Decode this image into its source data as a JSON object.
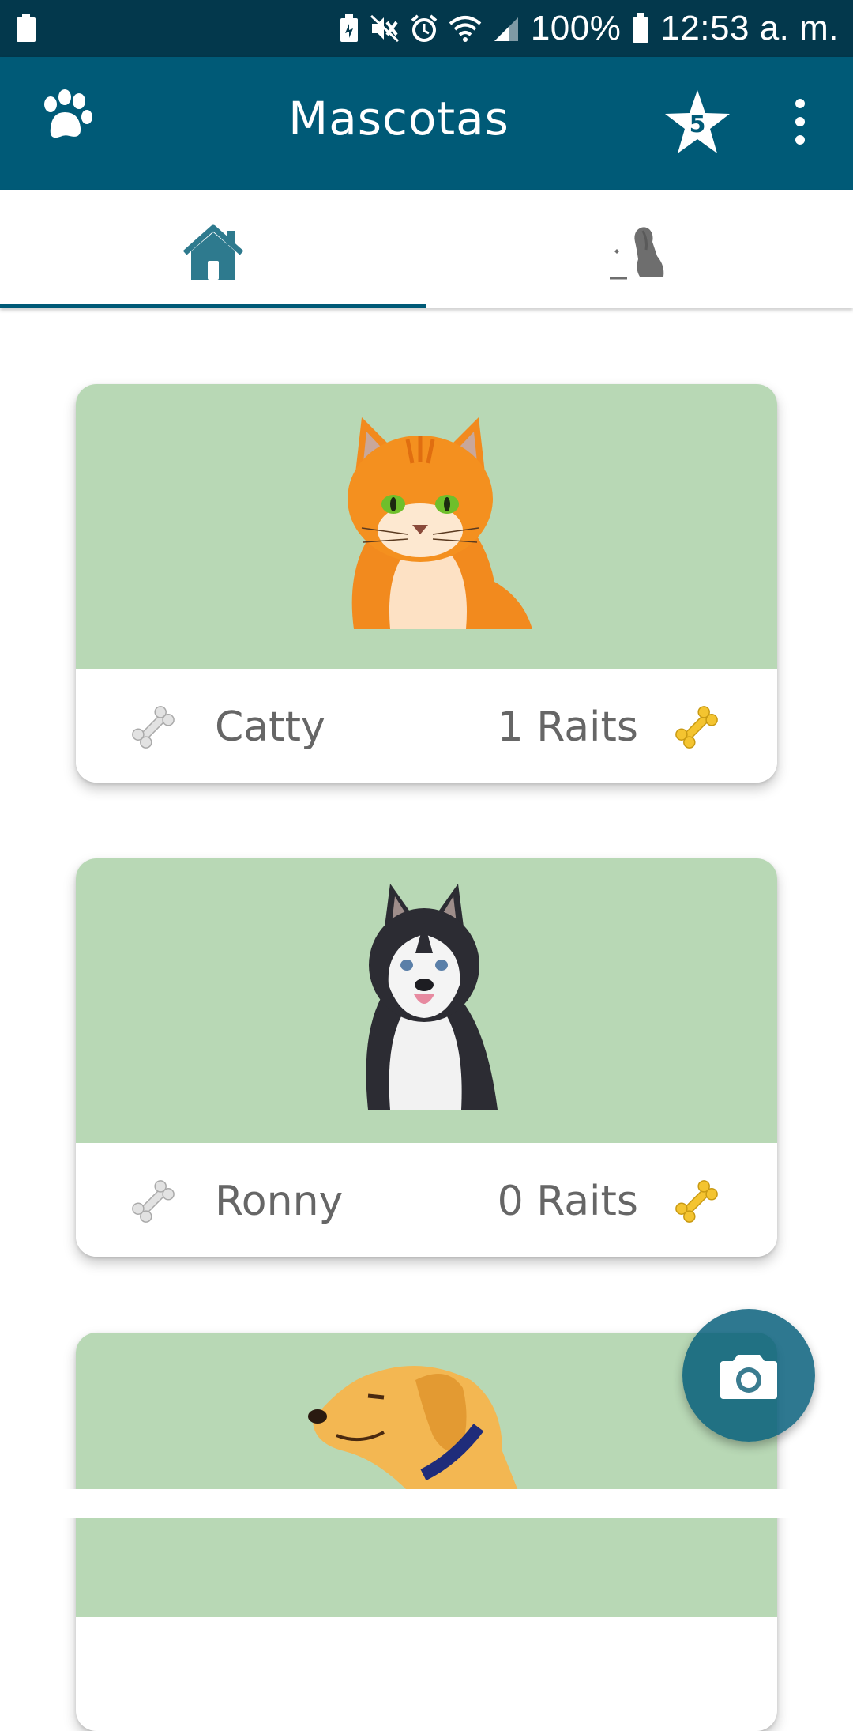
{
  "status_bar": {
    "battery_badge": "100",
    "battery_percent": "100%",
    "time": "12:53 a. m.",
    "icons": [
      "battery-saver-icon",
      "mute-icon",
      "alarm-icon",
      "wifi-icon",
      "signal-icon",
      "battery-icon"
    ]
  },
  "app_bar": {
    "title": "Mascotas",
    "logo_icon": "paw-icon",
    "favorites_count": "5",
    "favorites_icon": "star-icon",
    "menu_icon": "more-vertical-icon"
  },
  "tabs": [
    {
      "icon": "home-icon",
      "selected": true
    },
    {
      "icon": "dog-profile-icon",
      "selected": false
    }
  ],
  "pets": [
    {
      "name": "Catty",
      "raits": "1 Raits",
      "animal": "orange-cat",
      "bg": "#b8d8b5"
    },
    {
      "name": "Ronny",
      "raits": "0 Raits",
      "animal": "husky-dog",
      "bg": "#b8d8b5"
    },
    {
      "name": "",
      "raits": "",
      "animal": "golden-retriever-dog",
      "bg": "#b8d8b5"
    }
  ],
  "fab": {
    "icon": "camera-icon"
  },
  "colors": {
    "primary": "#005a77",
    "status_bar": "#03384c",
    "card_image_bg": "#b8d8b5",
    "text_secondary": "#666666",
    "bone_gold": "#f4c430"
  }
}
